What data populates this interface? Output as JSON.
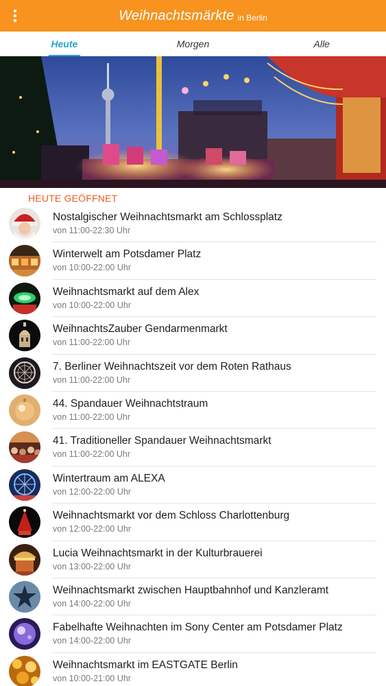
{
  "appbar": {
    "title": "Weihnachtsmärkte",
    "subtitle": "in Berlin",
    "menu_icon": "menu-dots-icon",
    "color": "#f7931e"
  },
  "tabs": [
    {
      "label": "Heute",
      "active": true
    },
    {
      "label": "Morgen",
      "active": false
    },
    {
      "label": "Alle",
      "active": false
    }
  ],
  "accent_color": "#27a6c8",
  "section_title": "HEUTE GEÖFFNET",
  "markets": [
    {
      "name": "Nostalgischer Weihnachtsmarkt am Schlossplatz",
      "hours": "von 11:00-22:30 Uhr",
      "thumb": "santa"
    },
    {
      "name": "Winterwelt am Potsdamer Platz",
      "hours": "von 10:00-22:00 Uhr",
      "thumb": "market-stalls"
    },
    {
      "name": "Weihnachtsmarkt auf dem Alex",
      "hours": "von 10:00-22:00 Uhr",
      "thumb": "green-lights"
    },
    {
      "name": "WeihnachtsZauber Gendarmenmarkt",
      "hours": "von 11:00-22:00 Uhr",
      "thumb": "dome"
    },
    {
      "name": "7. Berliner Weihnachtszeit vor dem Roten Rathaus",
      "hours": "von 11:00-22:00 Uhr",
      "thumb": "ferris-wheel"
    },
    {
      "name": "44. Spandauer Weihnachtstraum",
      "hours": "von 11:00-22:00 Uhr",
      "thumb": "golden-ornament"
    },
    {
      "name": "41. Traditioneller Spandauer Weihnachtsmarkt",
      "hours": "von 11:00-22:00 Uhr",
      "thumb": "crowd"
    },
    {
      "name": "Wintertraum am ALEXA",
      "hours": "von 12:00-22:00 Uhr",
      "thumb": "blue-wheel"
    },
    {
      "name": "Weihnachtsmarkt vor dem Schloss Charlottenburg",
      "hours": "von 12:00-22:00 Uhr",
      "thumb": "red-tree"
    },
    {
      "name": "Lucia Weihnachtsmarkt in der Kulturbrauerei",
      "hours": "von 13:00-22:00 Uhr",
      "thumb": "carousel"
    },
    {
      "name": "Weihnachtsmarkt zwischen Hauptbahnhof und Kanzleramt",
      "hours": "von 14:00-22:00 Uhr",
      "thumb": "star"
    },
    {
      "name": "Fabelhafte Weihnachten im Sony Center am Potsdamer Platz",
      "hours": "von 14:00-22:00 Uhr",
      "thumb": "purple-ball"
    },
    {
      "name": "Weihnachtsmarkt im EASTGATE Berlin",
      "hours": "von 10:00-21:00 Uhr",
      "thumb": "bokeh"
    }
  ]
}
